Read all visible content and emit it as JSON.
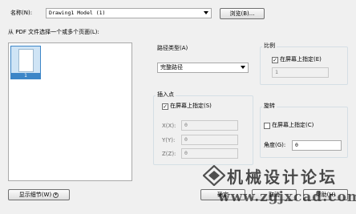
{
  "name": {
    "label": "名称(N):",
    "value": "Drawing1 Model (1)",
    "browse_label": "浏览(B)..."
  },
  "pages": {
    "label": "从 PDF 文件选择一个或多个页面(L):",
    "items": [
      {
        "number": "1"
      }
    ]
  },
  "path_type": {
    "label": "路径类型(A)",
    "value": "完整路径"
  },
  "scale": {
    "title": "比例",
    "specify_label": "在屏幕上指定(E)",
    "specify_checked": true,
    "value": "1"
  },
  "insertion": {
    "title": "插入点",
    "specify_label": "在屏幕上指定(S)",
    "specify_checked": true,
    "x_label": "X(X):",
    "x_value": "0",
    "y_label": "Y(Y):",
    "y_value": "0",
    "z_label": "Z(Z):",
    "z_value": "0"
  },
  "rotation": {
    "title": "旋转",
    "specify_label": "在屏幕上指定(C)",
    "specify_checked": false,
    "angle_label": "角度(G):",
    "angle_value": "0"
  },
  "footer": {
    "details_label": "显示细节(W)",
    "ok_label": "确定",
    "cancel_label": "取消",
    "help_label": "帮助(H)"
  },
  "watermark": {
    "site_name": "机械设计论坛",
    "url": "www.zgjxcad.com"
  }
}
